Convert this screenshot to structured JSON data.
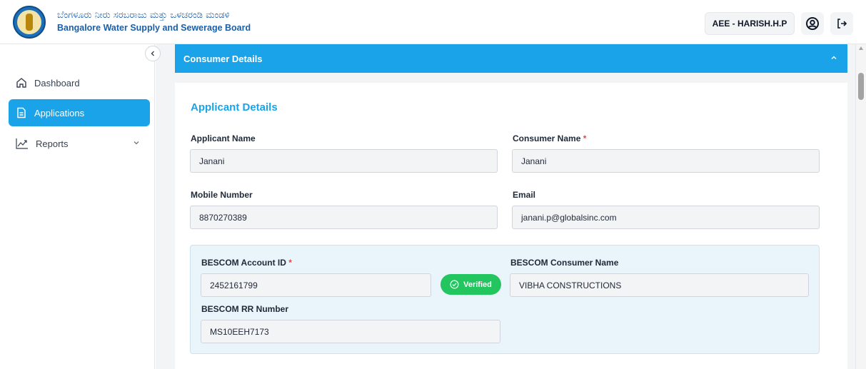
{
  "header": {
    "title_kannada": "ಬೆಂಗಳೂರು ನೀರು ಸರಬರಾಜು ಮತ್ತು ಒಳಚರಂಡಿ ಮಂಡಳಿ",
    "title_english": "Bangalore Water Supply and Sewerage Board",
    "user": "AEE - HARISH.H.P",
    "icons": [
      "bwssb-logo",
      "user-circle-icon",
      "logout-icon"
    ]
  },
  "sidebar": {
    "items": [
      {
        "label": "Dashboard",
        "icon": "home-icon",
        "active": false
      },
      {
        "label": "Applications",
        "icon": "document-icon",
        "active": true
      },
      {
        "label": "Reports",
        "icon": "trend-chart-icon",
        "active": false
      }
    ]
  },
  "main": {
    "accordion_title": "Consumer Details",
    "section_title": "Applicant Details",
    "fields": {
      "applicant_name": {
        "label": "Applicant Name",
        "value": "Janani"
      },
      "consumer_name": {
        "label": "Consumer Name",
        "value": "Janani",
        "required_mark": "*"
      },
      "mobile": {
        "label": "Mobile Number",
        "value": "8870270389"
      },
      "email": {
        "label": "Email",
        "value": "janani.p@globalsinc.com"
      }
    },
    "bescom": {
      "account_id": {
        "label": "BESCOM Account ID",
        "value": "2452161799",
        "required_mark": "*"
      },
      "verified_label": "Verified",
      "consumer_name": {
        "label": "BESCOM Consumer Name",
        "value": "VIBHA CONSTRUCTIONS"
      },
      "rr_number": {
        "label": "BESCOM RR Number",
        "value": "MS10EEH7173"
      }
    }
  },
  "colors": {
    "accent": "#1aa3e8",
    "brand": "#1a5fa8",
    "verified": "#22c55e",
    "required": "#ef4444"
  }
}
